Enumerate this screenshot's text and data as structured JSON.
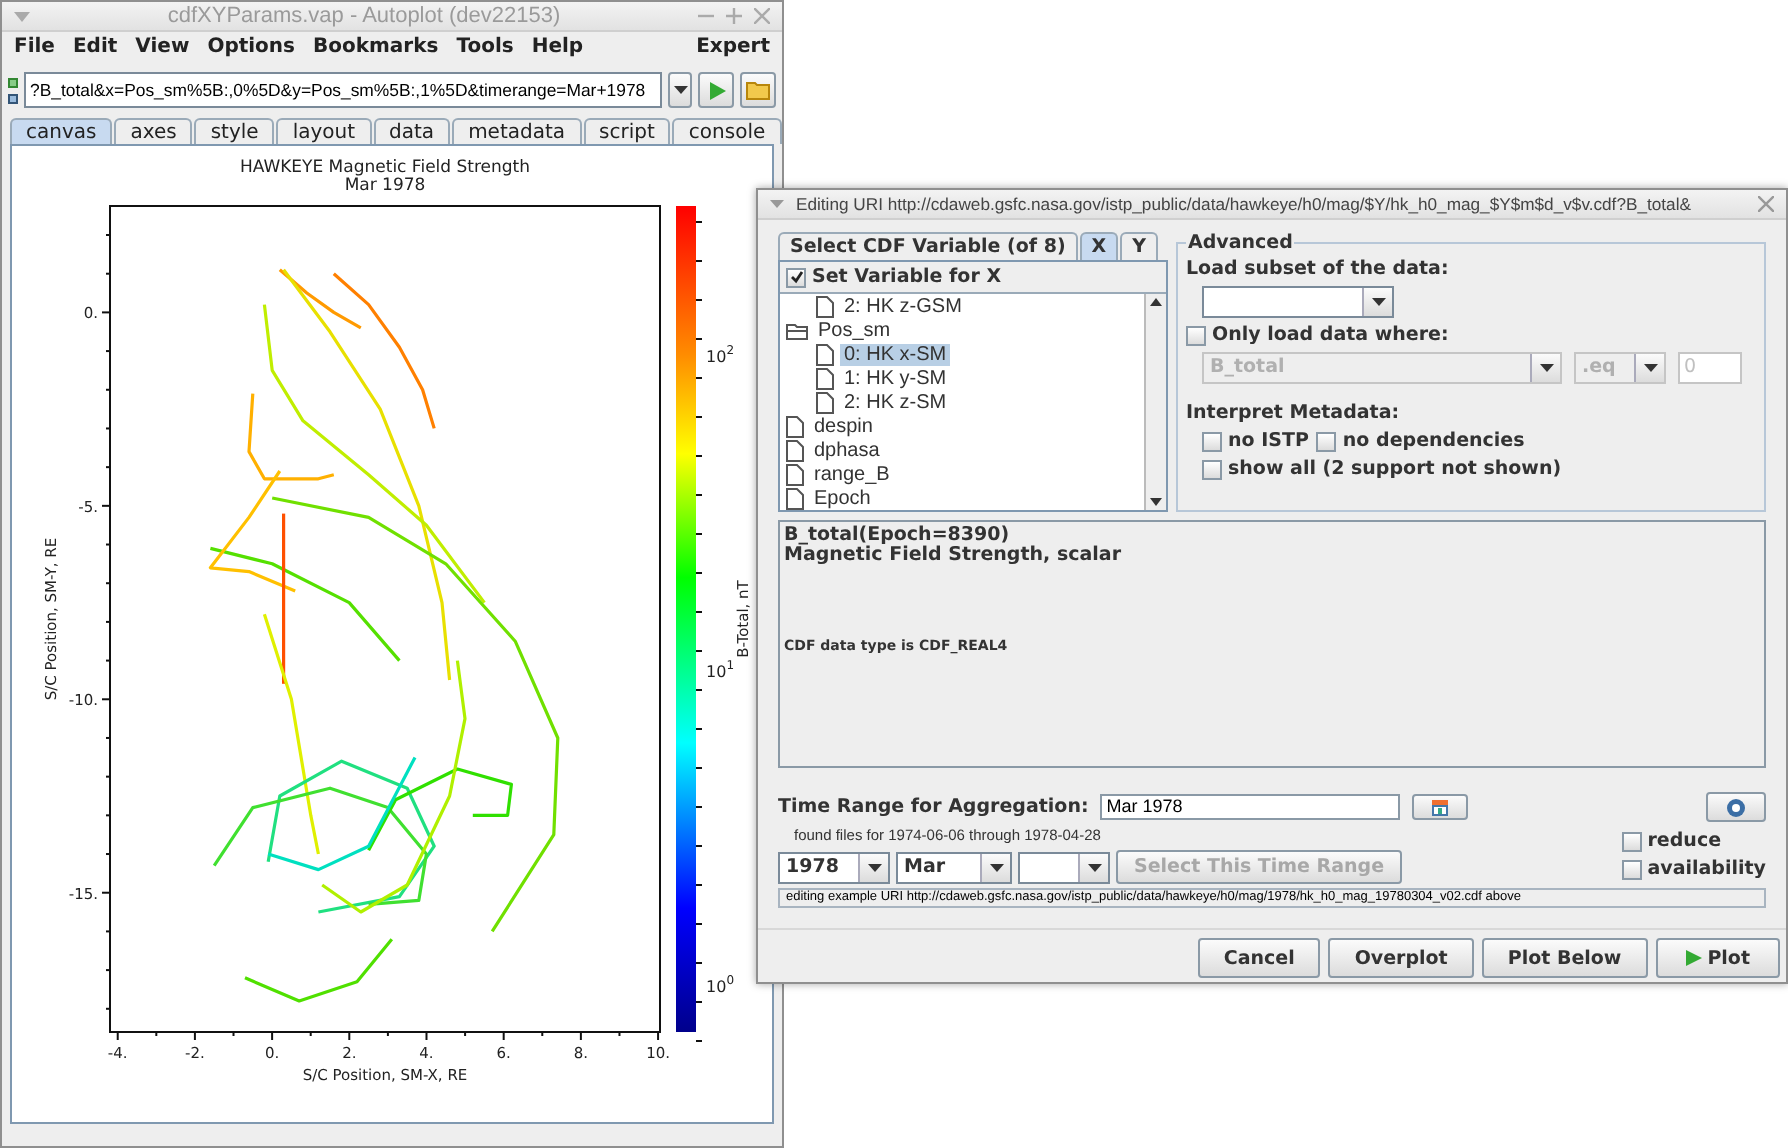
{
  "main_window": {
    "title": "cdfXYParams.vap - Autoplot (dev22153)",
    "menu": [
      {
        "label": "File"
      },
      {
        "label": "Edit"
      },
      {
        "label": "View"
      },
      {
        "label": "Options"
      },
      {
        "label": "Bookmarks"
      },
      {
        "label": "Tools"
      },
      {
        "label": "Help"
      }
    ],
    "menu_right": "Expert",
    "uri_field": {
      "value": "?B_total&x=Pos_sm%5B:,0%5D&y=Pos_sm%5B:,1%5D&timerange=Mar+1978"
    },
    "tabs": [
      {
        "label": "canvas",
        "selected": true
      },
      {
        "label": "axes",
        "selected": false
      },
      {
        "label": "style",
        "selected": false
      },
      {
        "label": "layout",
        "selected": false
      },
      {
        "label": "data",
        "selected": false
      },
      {
        "label": "metadata",
        "selected": false
      },
      {
        "label": "script",
        "selected": false
      },
      {
        "label": "console",
        "selected": false
      }
    ],
    "plot": {
      "title": [
        "HAWKEYE  Magnetic Field Strength",
        "Mar 1978"
      ],
      "chart_data": {
        "type": "line",
        "xlabel": "S/C Position, SM-X, RE",
        "ylabel": "S/C Position, SM-Y, RE",
        "xlim": [
          -4.2,
          10.05
        ],
        "ylim": [
          -18.6,
          2.75
        ],
        "xticks": [
          {
            "value": -4,
            "label": "-4."
          },
          {
            "value": -2,
            "label": "-2."
          },
          {
            "value": 0,
            "label": "0."
          },
          {
            "value": 2,
            "label": "2."
          },
          {
            "value": 4,
            "label": "4."
          },
          {
            "value": 6,
            "label": "6."
          },
          {
            "value": 8,
            "label": "8."
          },
          {
            "value": 10,
            "label": "10."
          }
        ],
        "yticks": [
          {
            "value": 0,
            "label": "0."
          },
          {
            "value": -5,
            "label": "-5."
          },
          {
            "value": -10,
            "label": "-10."
          },
          {
            "value": -15,
            "label": "-15."
          }
        ],
        "series": [
          {
            "color": "#ff8000",
            "x": [
              1.6,
              2.5,
              3.3,
              3.9,
              4.2
            ],
            "values": [
              1.0,
              0.2,
              -0.9,
              -2.0,
              -3.0
            ]
          },
          {
            "color": "#ff9a00",
            "x": [
              0.2,
              0.9,
              1.6,
              2.3
            ],
            "values": [
              1.1,
              0.5,
              0.0,
              -0.4
            ]
          },
          {
            "color": "#e8e000",
            "x": [
              0.3,
              1.5,
              2.8,
              3.8,
              4.4,
              4.6
            ],
            "values": [
              1.1,
              -0.5,
              -2.5,
              -5.0,
              -7.5,
              -9.5
            ]
          },
          {
            "color": "#c0ee00",
            "x": [
              -0.2,
              0.0,
              0.8,
              2.5,
              4.0,
              5.5
            ],
            "values": [
              0.2,
              -1.5,
              -2.8,
              -4.2,
              -5.5,
              -7.5
            ]
          },
          {
            "color": "#70e000",
            "x": [
              0.0,
              2.5,
              4.5,
              6.3,
              7.4,
              7.3,
              5.7
            ],
            "values": [
              -4.8,
              -5.3,
              -6.5,
              -8.5,
              -11.0,
              -13.5,
              -16.0
            ]
          },
          {
            "color": "#55e000",
            "x": [
              -1.6,
              0.0,
              2.0,
              3.3
            ],
            "values": [
              -6.1,
              -6.5,
              -7.5,
              -9.0
            ]
          },
          {
            "color": "#ffb000",
            "x": [
              -0.5,
              -0.6,
              -0.2,
              1.2,
              1.6
            ],
            "values": [
              -2.1,
              -3.6,
              -4.3,
              -4.3,
              -4.2
            ]
          },
          {
            "color": "#ffc000",
            "x": [
              0.2,
              -0.6,
              -1.6,
              -0.6,
              0.6
            ],
            "values": [
              -4.1,
              -5.3,
              -6.6,
              -6.7,
              -7.2
            ]
          },
          {
            "color": "#ff5000",
            "x": [
              0.3,
              0.3
            ],
            "values": [
              -5.2,
              -9.6
            ]
          },
          {
            "color": "#e0f000",
            "x": [
              -0.2,
              0.5,
              1.0,
              1.2
            ],
            "values": [
              -7.8,
              -10.0,
              -13.0,
              -14.0
            ]
          },
          {
            "color": "#20e080",
            "x": [
              -0.1,
              0.2,
              1.8,
              3.5,
              4.2,
              3.3,
              1.2
            ],
            "values": [
              -14.2,
              -12.5,
              -11.6,
              -12.3,
              -13.8,
              -15.1,
              -15.5
            ]
          },
          {
            "color": "#40e030",
            "x": [
              -1.5,
              -0.5,
              1.5,
              3.0,
              4.0,
              3.8,
              2.5
            ],
            "values": [
              -14.3,
              -12.8,
              -12.3,
              -12.8,
              -14.0,
              -15.2,
              -15.3
            ]
          },
          {
            "color": "#30e000",
            "x": [
              2.5,
              3.2,
              4.8,
              6.2,
              6.1,
              5.2
            ],
            "values": [
              -13.9,
              -12.6,
              -11.8,
              -12.2,
              -13.0,
              -13.0
            ]
          },
          {
            "color": "#50e000",
            "x": [
              -0.7,
              0.7,
              2.2,
              3.1
            ],
            "values": [
              -17.2,
              -17.8,
              -17.3,
              -16.2
            ]
          },
          {
            "color": "#b0f000",
            "x": [
              1.3,
              2.3,
              3.5,
              4.6,
              5.0,
              4.8
            ],
            "values": [
              -14.8,
              -15.5,
              -14.8,
              -12.5,
              -10.5,
              -9.0
            ]
          },
          {
            "color": "#00e0c0",
            "x": [
              -0.1,
              1.2,
              2.5,
              3.7
            ],
            "values": [
              -14.0,
              -14.4,
              -13.8,
              -11.5
            ]
          }
        ]
      },
      "colorbar": {
        "label": "B-Total, nT",
        "ticks": [
          {
            "base": "10",
            "exponent": "2"
          },
          {
            "base": "10",
            "exponent": "1"
          },
          {
            "base": "10",
            "exponent": "0"
          }
        ]
      }
    }
  },
  "dialog": {
    "title": "Editing URI http://cdaweb.gsfc.nasa.gov/istp_public/data/hawkeye/h0/mag/$Y/hk_h0_mag_$Y$m$d_v$v.cdf?B_total&",
    "variable_tabs": [
      {
        "label": "Select CDF Variable (of 8)",
        "selected": false
      },
      {
        "label": "X",
        "selected": true
      },
      {
        "label": "Y",
        "selected": false
      }
    ],
    "set_variable": {
      "label": "Set Variable for X",
      "checked": true
    },
    "tree": [
      {
        "children": [
          {
            "kind": "file",
            "label": "2: HK z-GSM",
            "selected": false
          }
        ]
      },
      {
        "kind": "folder",
        "label": "Pos_sm",
        "expanded": true,
        "children": [
          {
            "kind": "file",
            "label": "0: HK x-SM",
            "selected": true
          },
          {
            "kind": "file",
            "label": "1: HK y-SM",
            "selected": false
          },
          {
            "kind": "file",
            "label": "2: HK z-SM",
            "selected": false
          }
        ]
      },
      {
        "kind": "file",
        "label": "despin",
        "selected": false
      },
      {
        "kind": "file",
        "label": "dphasa",
        "selected": false
      },
      {
        "kind": "file",
        "label": "range_B",
        "selected": false
      },
      {
        "kind": "file",
        "label": "Epoch",
        "selected": false
      }
    ],
    "advanced": {
      "legend": "Advanced",
      "subset_label": "Load subset of the data:",
      "only_load": {
        "label": "Only load data where:",
        "checked": false
      },
      "where_variable": {
        "value": "B_total",
        "disabled": true
      },
      "where_op": {
        "value": ".eq",
        "disabled": true
      },
      "where_value": {
        "value": "0",
        "disabled": true
      },
      "metadata_label": "Interpret Metadata:",
      "metadata_options": [
        [
          {
            "label": "no ISTP",
            "checked": false
          },
          {
            "label": "no dependencies",
            "checked": false
          }
        ],
        [
          {
            "label": "show all (2 support not shown)",
            "checked": false
          }
        ]
      ]
    },
    "description": [
      "B_total(Epoch=8390)",
      "Magnetic Field Strength, scalar"
    ],
    "data_type": "CDF data type is CDF_REAL4",
    "time_range_label": "Time Range for Aggregation:",
    "time_range": {
      "value": "Mar 1978"
    },
    "found_files": "found files for 1974-06-06 through 1978-04-28",
    "year": "1978",
    "month": "Mar",
    "select_range": {
      "label": "Select This Time Range",
      "disabled": true
    },
    "options": [
      {
        "label": "reduce",
        "checked": false
      },
      {
        "label": "availability",
        "checked": false
      }
    ],
    "example_uri": "editing example URI http://cdaweb.gsfc.nasa.gov/istp_public/data/hawkeye/h0/mag/1978/hk_h0_mag_19780304_v02.cdf above",
    "buttons": [
      {
        "label": "Cancel",
        "kind": "plain"
      },
      {
        "label": "Overplot",
        "kind": "plain"
      },
      {
        "label": "Plot Below",
        "kind": "plain"
      },
      {
        "label": "Plot",
        "kind": "play"
      }
    ]
  }
}
